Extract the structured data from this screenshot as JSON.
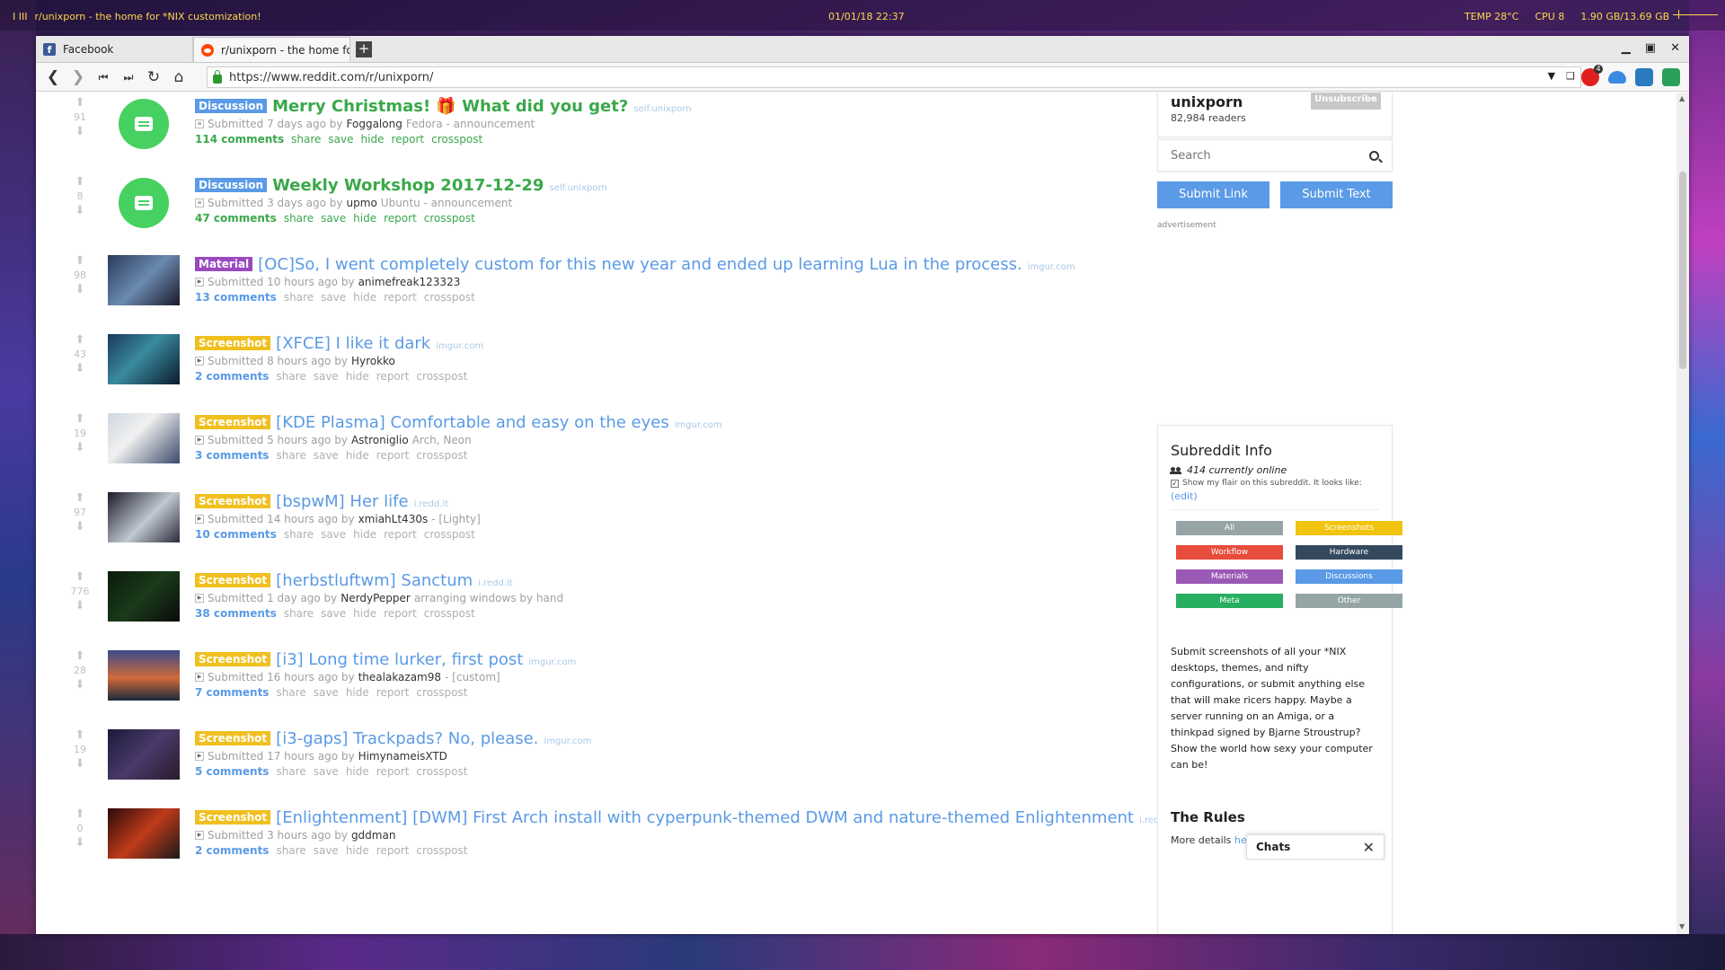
{
  "topbar": {
    "workspaces": "I III",
    "window_title": "r/unixporn - the home for *NIX customization!",
    "datetime": "01/01/18 22:37",
    "temp": "TEMP 28°C",
    "cpu": "CPU 8",
    "mem": "1.90 GB/13.69 GB"
  },
  "tabs": [
    {
      "label": "Facebook"
    },
    {
      "label": "r/unixporn - the home for"
    }
  ],
  "newtab_label": "+",
  "window_controls": {
    "minimize": "▁",
    "maximize": "▣",
    "close": "✕"
  },
  "nav": {
    "back": "❮",
    "forward": "❯",
    "first": "⏮",
    "last": "⏭",
    "reload": "↻",
    "home": "⌂",
    "url": "https://www.reddit.com/r/unixporn/",
    "dropdown": "▼",
    "bookmark": "❑",
    "opera_badge": "4"
  },
  "colors": {
    "link_blue": "#5a9ae6",
    "sticky_green": "#3aa84a",
    "flair_screenshot": "#f0c020",
    "flair_material": "#9a4ac0",
    "flair_discussion": "#5a9ae6"
  },
  "icons": {
    "up": "⬆",
    "down": "⬇"
  },
  "posts": [
    {
      "score": "91",
      "flair": "Discussion",
      "title": "Merry Christmas! 🎁 What did you get?",
      "domain": "self.unixporn",
      "submitted": "Submitted 7 days ago by",
      "author": "Foggalong",
      "extra": "Fedora - announcement",
      "comments": "114 comments",
      "actions": [
        "share",
        "save",
        "hide",
        "report",
        "crosspost"
      ]
    },
    {
      "score": "8",
      "flair": "Discussion",
      "title": "Weekly Workshop 2017-12-29",
      "domain": "self.unixporn",
      "submitted": "Submitted 3 days ago by",
      "author": "upmo",
      "extra": "Ubuntu - announcement",
      "comments": "47 comments",
      "actions": [
        "share",
        "save",
        "hide",
        "report",
        "crosspost"
      ]
    },
    {
      "score": "98",
      "flair": "Material",
      "title": "[OC]So, I went completely custom for this new year and ended up learning Lua in the process.",
      "domain": "imgur.com",
      "submitted": "Submitted 10 hours ago by",
      "author": "animefreak123323",
      "extra": "",
      "comments": "13 comments",
      "actions": [
        "share",
        "save",
        "hide",
        "report",
        "crosspost"
      ]
    },
    {
      "score": "43",
      "flair": "Screenshot",
      "title": "[XFCE] I like it dark",
      "domain": "imgur.com",
      "submitted": "Submitted 8 hours ago by",
      "author": "Hyrokko",
      "extra": "",
      "comments": "2 comments",
      "actions": [
        "share",
        "save",
        "hide",
        "report",
        "crosspost"
      ]
    },
    {
      "score": "19",
      "flair": "Screenshot",
      "title": "[KDE Plasma] Comfortable and easy on the eyes",
      "domain": "imgur.com",
      "submitted": "Submitted 5 hours ago by",
      "author": "Astroniglio",
      "extra": "Arch, Neon",
      "comments": "3 comments",
      "actions": [
        "share",
        "save",
        "hide",
        "report",
        "crosspost"
      ]
    },
    {
      "score": "97",
      "flair": "Screenshot",
      "title": "[bspwM] Her life",
      "domain": "i.redd.it",
      "submitted": "Submitted 14 hours ago by",
      "author": "xmiahLt430s",
      "extra": "- [Lighty]",
      "comments": "10 comments",
      "actions": [
        "share",
        "save",
        "hide",
        "report",
        "crosspost"
      ]
    },
    {
      "score": "776",
      "flair": "Screenshot",
      "title": "[herbstluftwm] Sanctum",
      "domain": "i.redd.it",
      "submitted": "Submitted 1 day ago by",
      "author": "NerdyPepper",
      "extra": "arranging windows by hand",
      "comments": "38 comments",
      "actions": [
        "share",
        "save",
        "hide",
        "report",
        "crosspost"
      ]
    },
    {
      "score": "28",
      "flair": "Screenshot",
      "title": "[i3] Long time lurker, first post",
      "domain": "imgur.com",
      "submitted": "Submitted 16 hours ago by",
      "author": "thealakazam98",
      "extra": "- [custom]",
      "comments": "7 comments",
      "actions": [
        "share",
        "save",
        "hide",
        "report",
        "crosspost"
      ]
    },
    {
      "score": "19",
      "flair": "Screenshot",
      "title": "[i3-gaps] Trackpads? No, please.",
      "domain": "imgur.com",
      "submitted": "Submitted 17 hours ago by",
      "author": "HimynameisXTD",
      "extra": "",
      "comments": "5 comments",
      "actions": [
        "share",
        "save",
        "hide",
        "report",
        "crosspost"
      ]
    },
    {
      "score": "0",
      "flair": "Screenshot",
      "title": "[Enlightenment] [DWM] First Arch install with cyperpunk-themed DWM and nature-themed Enlightenment",
      "domain": "i.redd.it",
      "submitted": "Submitted 3 hours ago by",
      "author": "gddman",
      "extra": "",
      "comments": "2 comments",
      "actions": [
        "share",
        "save",
        "hide",
        "report",
        "crosspost"
      ]
    }
  ],
  "sidebar": {
    "sub_name": "unixporn",
    "readers": "82,984 readers",
    "unsubscribe": "Unsubscribe",
    "search_placeholder": "Search",
    "submit_link": "Submit Link",
    "submit_text": "Submit Text",
    "ad_label": "advertisement",
    "info_title": "Subreddit Info",
    "online": "414 currently online",
    "flair_option": "Show my flair on this subreddit. It looks like:",
    "edit": "(edit)",
    "filters": [
      {
        "label": "All",
        "color": "#95a5a6"
      },
      {
        "label": "Screenshots",
        "color": "#f1c40f"
      },
      {
        "label": "Workflow",
        "color": "#e74c3c"
      },
      {
        "label": "Hardware",
        "color": "#34495e"
      },
      {
        "label": "Materials",
        "color": "#9b59b6"
      },
      {
        "label": "Discussions",
        "color": "#5a9ae6"
      },
      {
        "label": "Meta",
        "color": "#27ae60"
      },
      {
        "label": "Other",
        "color": "#95a5a6"
      }
    ],
    "description": "Submit screenshots of all your *NIX desktops, themes, and nifty configurations, or submit anything else that will make ricers happy. Maybe a server running on an Amiga, or a thinkpad signed by Bjarne Stroustrup? Show the world how sexy your computer can be!",
    "rules_title": "The Rules",
    "more_details": "More details",
    "here": "here"
  },
  "chats": {
    "label": "Chats",
    "close": "✕"
  }
}
